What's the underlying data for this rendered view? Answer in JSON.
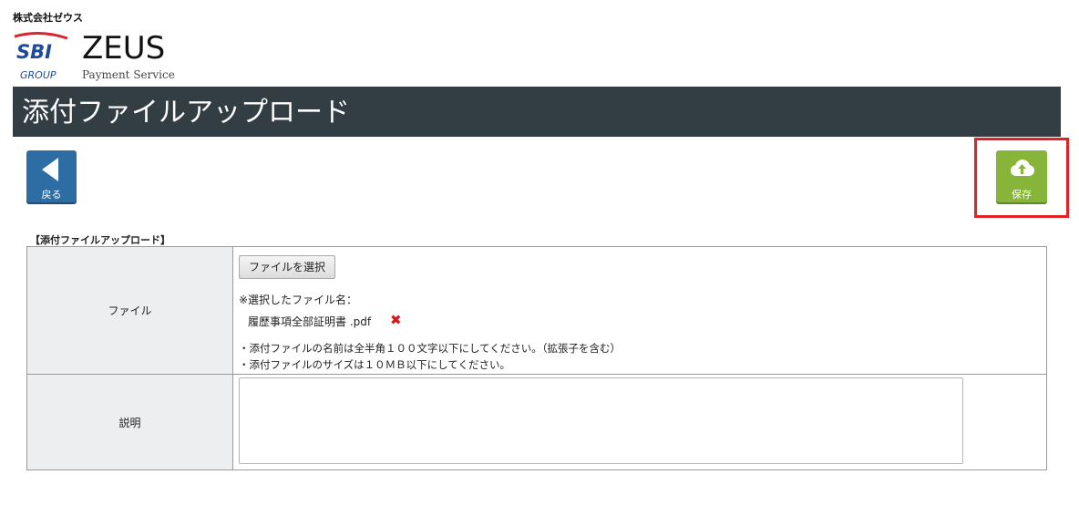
{
  "header": {
    "company": "株式会社ゼウス",
    "logo_sbi": "SBI",
    "logo_group": "GROUP",
    "logo_zeus": "ZEUS",
    "logo_tagline": "Payment Service"
  },
  "page_title": "添付ファイルアップロード",
  "toolbar": {
    "back_label": "戻る",
    "save_label": "保存",
    "back_icon": "triangle-left-icon",
    "save_icon": "cloud-upload-icon"
  },
  "section_title": "【添付ファイルアップロード】",
  "form": {
    "file_label": "ファイル",
    "file_button": "ファイルを選択",
    "selected_label": "※選択したファイル名：",
    "selected_file": "履歴事項全部証明書 .pdf",
    "delete_glyph": "✖",
    "note1": "・添付ファイルの名前は全半角１００文字以下にしてください。（拡張子を含む）",
    "note2": "・添付ファイルのサイズは１０ＭＢ以下にしてください。",
    "desc_label": "説明",
    "desc_value": ""
  },
  "colors": {
    "title_bar": "#323d44",
    "back_button": "#2e6da4",
    "save_button": "#87b53a",
    "highlight": "#e32228",
    "delete": "#d8161b"
  }
}
